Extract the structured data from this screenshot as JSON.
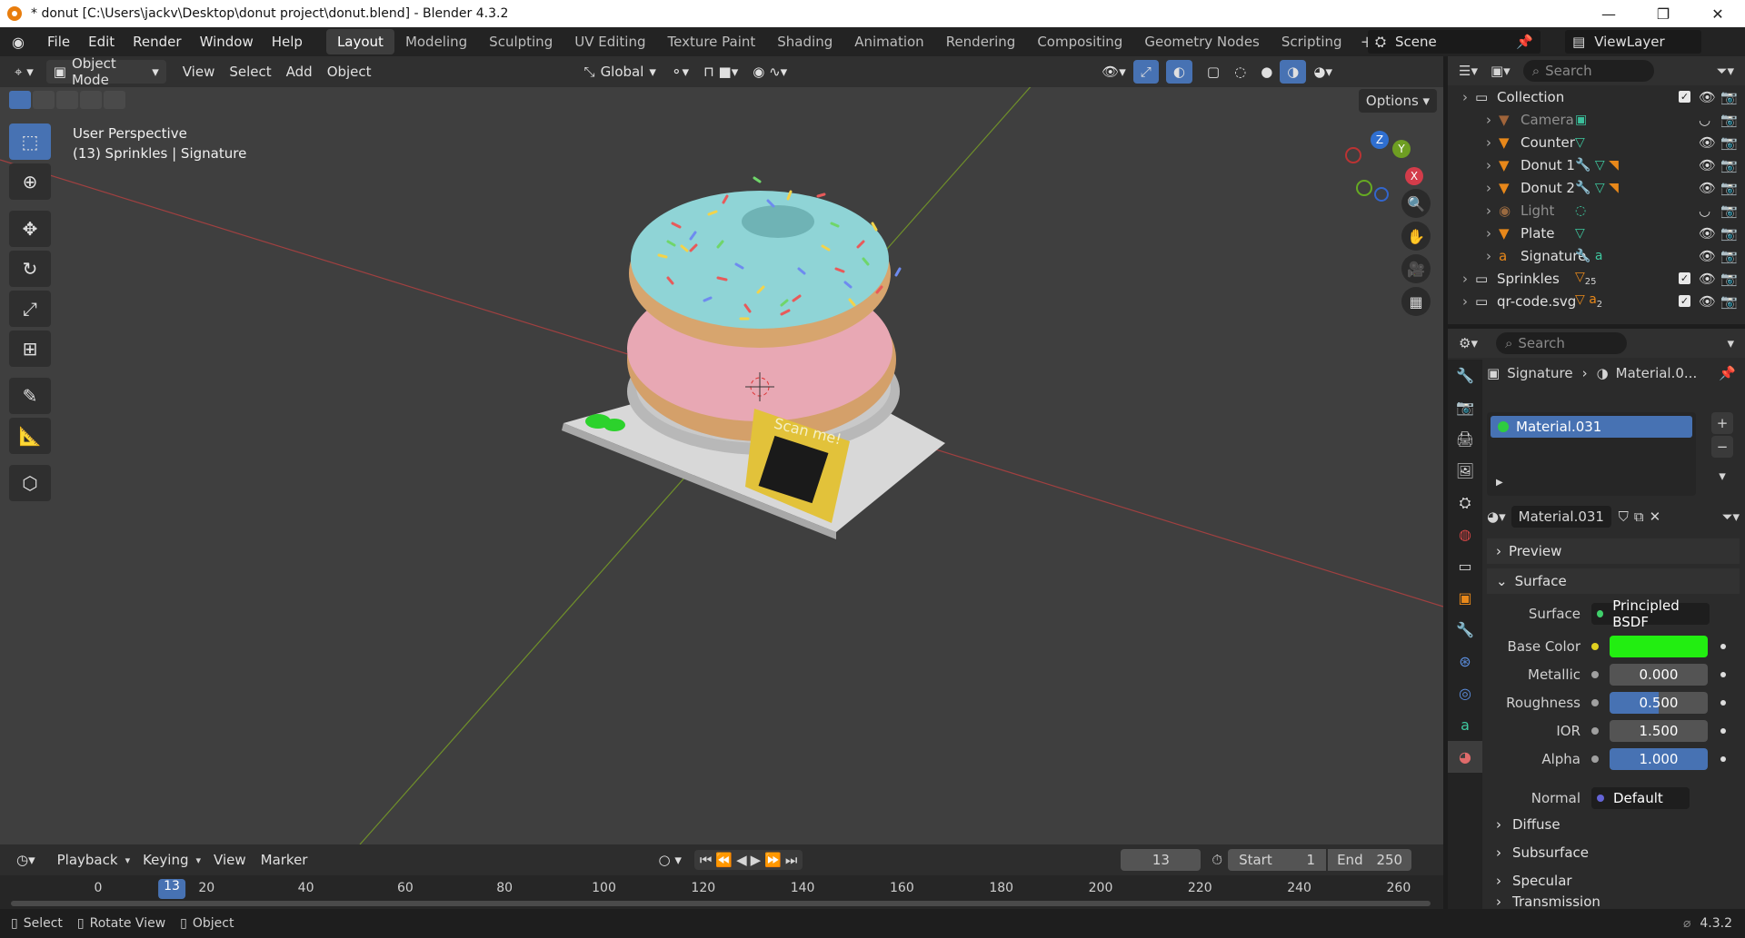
{
  "window": {
    "title": "* donut [C:\\Users\\jackv\\Desktop\\donut project\\donut.blend] - Blender 4.3.2",
    "minimize": "—",
    "maximize": "❐",
    "close": "✕"
  },
  "menu": {
    "items": [
      "File",
      "Edit",
      "Render",
      "Window",
      "Help"
    ]
  },
  "workspaces": {
    "tabs": [
      "Layout",
      "Modeling",
      "Sculpting",
      "UV Editing",
      "Texture Paint",
      "Shading",
      "Animation",
      "Rendering",
      "Compositing",
      "Geometry Nodes",
      "Scripting"
    ],
    "active": "Layout",
    "add": "+"
  },
  "scene": {
    "name": "Scene",
    "view_layer": "ViewLayer"
  },
  "viewport_header": {
    "mode": "Object Mode",
    "menus": [
      "View",
      "Select",
      "Add",
      "Object"
    ],
    "orientation": "Global",
    "options": "Options"
  },
  "viewport": {
    "perspective": "User Perspective",
    "context": "(13) Sprinkles | Signature",
    "qr_text": "Scan me!",
    "gizmo": {
      "z": "Z",
      "y": "Y",
      "x": "X"
    }
  },
  "outliner": {
    "search_placeholder": "Search",
    "rows": [
      {
        "name": "Collection"
      },
      {
        "name": "Camera"
      },
      {
        "name": "Counter"
      },
      {
        "name": "Donut 1"
      },
      {
        "name": "Donut 2"
      },
      {
        "name": "Light"
      },
      {
        "name": "Plate"
      },
      {
        "name": "Signature"
      },
      {
        "name": "Sprinkles",
        "count": "25"
      },
      {
        "name": "qr-code.svg",
        "count": "2"
      }
    ]
  },
  "properties": {
    "search_placeholder": "Search",
    "breadcrumb": {
      "object": "Signature",
      "material": "Material.0..."
    },
    "slot": "Material.031",
    "material_name": "Material.031",
    "sections": {
      "preview": "Preview",
      "surface": "Surface"
    },
    "surface_label": "Surface",
    "surface_value": "Principled BSDF",
    "fields": [
      {
        "label": "Base Color",
        "value": "",
        "color": "#22ee11"
      },
      {
        "label": "Metallic",
        "value": "0.000"
      },
      {
        "label": "Roughness",
        "value": "0.500"
      },
      {
        "label": "IOR",
        "value": "1.500"
      },
      {
        "label": "Alpha",
        "value": "1.000"
      }
    ],
    "normal_label": "Normal",
    "normal_value": "Default",
    "collapsed": [
      "Diffuse",
      "Subsurface",
      "Specular",
      "Transmission"
    ]
  },
  "timeline": {
    "menus": [
      "Playback",
      "Keying",
      "View",
      "Marker"
    ],
    "current_frame": "13",
    "start_label": "Start",
    "start": "1",
    "end_label": "End",
    "end": "250",
    "ruler": [
      "0",
      "20",
      "40",
      "60",
      "80",
      "100",
      "120",
      "140",
      "160",
      "180",
      "200",
      "220",
      "240",
      "260"
    ]
  },
  "statusbar": {
    "select": "Select",
    "rotate": "Rotate View",
    "object": "Object",
    "version": "4.3.2"
  }
}
